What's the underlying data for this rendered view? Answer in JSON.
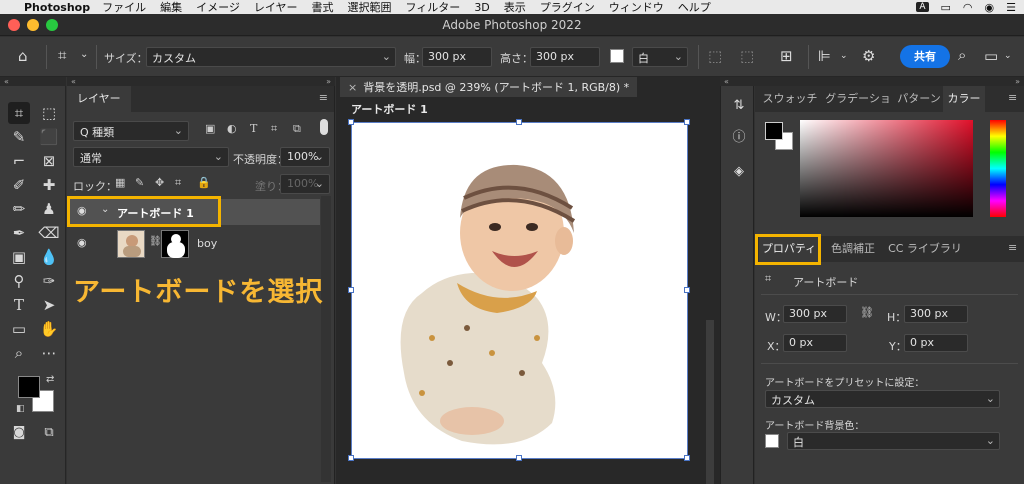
{
  "menubar": {
    "apple": "",
    "app": "Photoshop",
    "items": [
      "ファイル",
      "編集",
      "イメージ",
      "レイヤー",
      "書式",
      "選択範囲",
      "フィルター",
      "3D",
      "表示",
      "プラグイン",
      "ウィンドウ",
      "ヘルプ"
    ],
    "input_badge": "A"
  },
  "window": {
    "title": "Adobe Photoshop 2022"
  },
  "options": {
    "size_label": "サイズ：",
    "size_value": "カスタム",
    "width_label": "幅：",
    "width_value": "300 px",
    "height_label": "高さ：",
    "height_value": "300 px",
    "color_value": "白",
    "share_label": "共有"
  },
  "layers_panel": {
    "tab": "レイヤー",
    "filter_value": "Q 種類",
    "blend_mode": "通常",
    "opacity_label": "不透明度：",
    "opacity_value": "100%",
    "lock_label": "ロック：",
    "fill_label": "塗り：",
    "fill_value": "100%",
    "layers": [
      {
        "name": "アートボード 1"
      },
      {
        "name": "boy"
      }
    ]
  },
  "annotation": "アートボードを選択",
  "document": {
    "tab_title": "背景を透明.psd @ 239% (アートボード 1, RGB/8) *",
    "artboard_label": "アートボード 1"
  },
  "color_panel": {
    "tabs": [
      "スウォッチ",
      "グラデーショ",
      "パターン",
      "カラー"
    ],
    "active_tab": "カラー",
    "colors": {
      "hue": "#e0102a",
      "foreground": "#000000",
      "background": "#ffffff"
    }
  },
  "properties_panel": {
    "tabs": [
      "プロパティ",
      "色調補正",
      "CC ライブラリ"
    ],
    "section_title": "アートボード",
    "w_label": "W：",
    "w_value": "300 px",
    "h_label": "H：",
    "h_value": "300 px",
    "x_label": "X：",
    "x_value": "0 px",
    "y_label": "Y：",
    "y_value": "0 px",
    "preset_label": "アートボードをプリセットに設定：",
    "preset_value": "カスタム",
    "bg_label": "アートボード背景色：",
    "bg_value": "白"
  },
  "colors": {
    "highlight": "#f4b400",
    "accent": "#1473e6",
    "selected_row": "#525252"
  }
}
